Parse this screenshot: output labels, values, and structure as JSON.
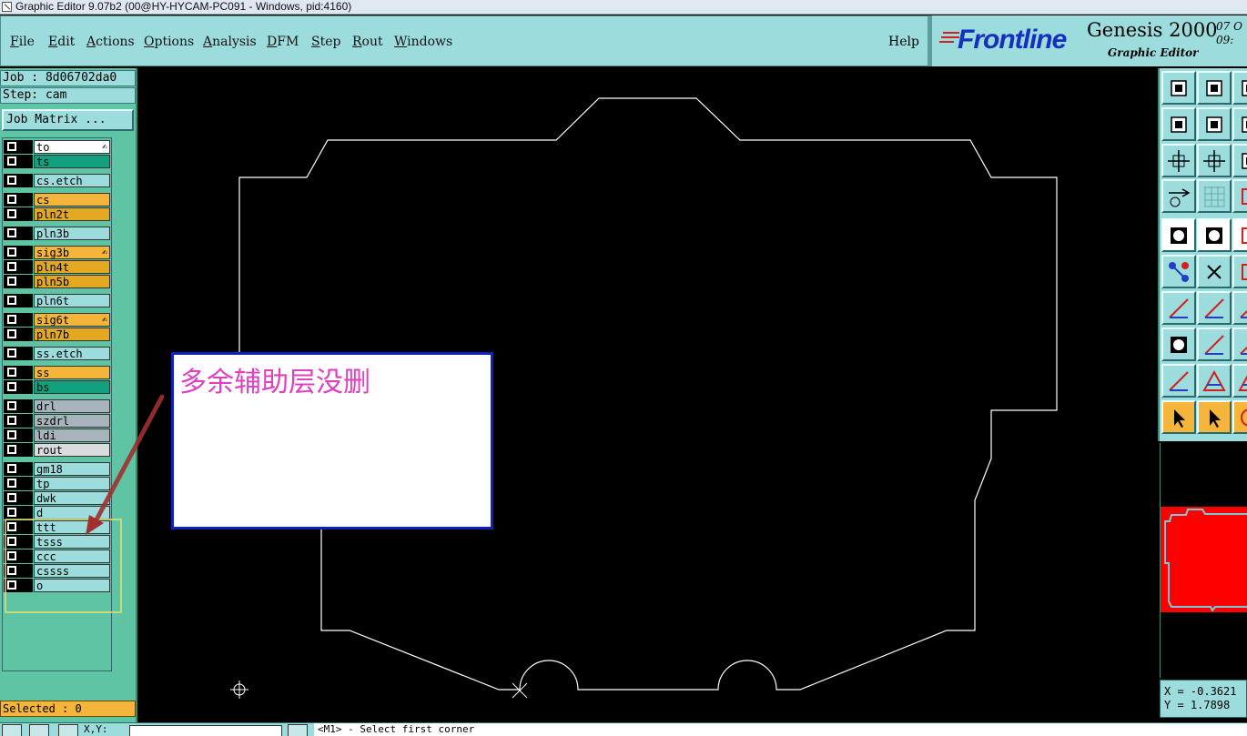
{
  "window": {
    "title": "Graphic Editor 9.07b2 (00@HY-HYCAM-PC091 - Windows, pid:4160)"
  },
  "menu": {
    "items": [
      {
        "label": "File",
        "u": "F",
        "rest": "ile"
      },
      {
        "label": "Edit",
        "u": "E",
        "rest": "dit"
      },
      {
        "label": "Actions",
        "u": "A",
        "rest": "ctions"
      },
      {
        "label": "Options",
        "u": "O",
        "rest": "ptions"
      },
      {
        "label": "Analysis",
        "u": "A",
        "rest": "nalysis"
      },
      {
        "label": "DFM",
        "u": "D",
        "rest": "FM"
      },
      {
        "label": "Step",
        "u": "S",
        "rest": "tep"
      },
      {
        "label": "Rout",
        "u": "R",
        "rest": "out"
      },
      {
        "label": "Windows",
        "u": "W",
        "rest": "indows"
      }
    ],
    "help": "Help"
  },
  "brand": {
    "logo_text": "Frontline",
    "product": "Genesis 2000",
    "subtitle": "Graphic Editor",
    "date_line1": "07 O",
    "date_line2": "09:"
  },
  "left_panel": {
    "job": "Job : 8d06702da0",
    "step": "Step: cam",
    "job_matrix": "Job Matrix ...",
    "layers": [
      {
        "name": "to",
        "color": "#ffffff",
        "mark": "✍"
      },
      {
        "name": "ts",
        "color": "#12a07e"
      },
      {
        "name": "cs.etch",
        "color": "#9ddcdc"
      },
      {
        "name": "cs",
        "color": "#f5b53a"
      },
      {
        "name": "pln2t",
        "color": "#e3a820"
      },
      {
        "name": "pln3b",
        "color": "#9ddcdc"
      },
      {
        "name": "sig3b",
        "color": "#f5b53a",
        "mark": "✍"
      },
      {
        "name": "pln4t",
        "color": "#e3a820"
      },
      {
        "name": "pln5b",
        "color": "#e3a820"
      },
      {
        "name": "pln6t",
        "color": "#9ddcdc"
      },
      {
        "name": "sig6t",
        "color": "#f5b53a",
        "mark": "✍"
      },
      {
        "name": "pln7b",
        "color": "#e3a820"
      },
      {
        "name": "ss.etch",
        "color": "#9ddcdc"
      },
      {
        "name": "ss",
        "color": "#f5b53a"
      },
      {
        "name": "bs",
        "color": "#12a07e"
      },
      {
        "name": "drl",
        "color": "#a8b4bc"
      },
      {
        "name": "szdrl",
        "color": "#a8b4bc"
      },
      {
        "name": "ldi",
        "color": "#a8b4bc"
      },
      {
        "name": "rout",
        "color": "#d8dcdc"
      },
      {
        "name": "gm18",
        "color": "#9ddcdc"
      },
      {
        "name": "tp",
        "color": "#9ddcdc"
      },
      {
        "name": "dwk",
        "color": "#9ddcdc"
      },
      {
        "name": "d",
        "color": "#9ddcdc"
      },
      {
        "name": "ttt",
        "color": "#9ddcdc"
      },
      {
        "name": "tsss",
        "color": "#9ddcdc"
      },
      {
        "name": "ccc",
        "color": "#9ddcdc"
      },
      {
        "name": "cssss",
        "color": "#9ddcdc"
      },
      {
        "name": "o",
        "color": "#9ddcdc"
      }
    ],
    "selected": "Selected : 0"
  },
  "annotation": {
    "text": "多余辅助层没删"
  },
  "right_toolbar": {
    "icons": [
      "move-up-icon",
      "move-down-icon",
      "home-icon",
      "move-left-icon",
      "move-right-icon",
      "undo-icon",
      "expand-icon",
      "zoom-fit-icon",
      "redo-icon",
      "measure-ruler-icon",
      "grid-icon",
      "snap-icon",
      "pad-feature-icon",
      "surface-feature-icon",
      "text-feature-icon",
      "connect-nodes-icon",
      "cross-node-icon",
      "node-icon",
      "line-angle-icon",
      "line-draw-icon",
      "line-extra-icon",
      "pad-select-icon",
      "line-split-icon",
      "arrow-line-icon",
      "triangle-outline-icon",
      "triangle-split-icon",
      "triangle-extra-icon",
      "pointer-select-icon",
      "pointer-box-icon",
      "circle-select-icon"
    ]
  },
  "coords": {
    "x": "X = -0.3621",
    "y": "Y =  1.7898"
  },
  "bottom": {
    "xy_label": "X,Y:",
    "prompt": "<M1> - Select first corner"
  },
  "colors": {
    "panel": "#9ddcdc",
    "panel_green": "#5fc4a4",
    "annotation_text": "#e040c0",
    "annotation_border": "#1020c0",
    "highlight_box": "#e8e070",
    "arrow": "#a03030",
    "preview_fill": "#ff0000"
  }
}
